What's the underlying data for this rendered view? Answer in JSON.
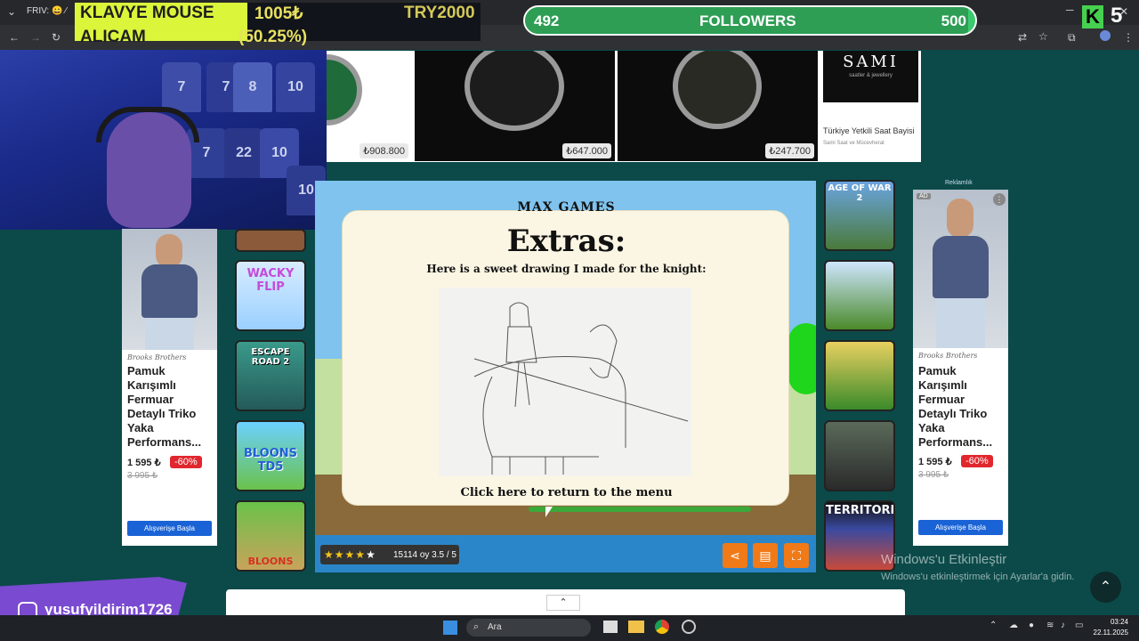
{
  "browser": {
    "tab_label": "FRIV: 😀 ⁄",
    "menu_dots": "⋮",
    "minimize": "─",
    "close": "✕"
  },
  "donation": {
    "line1_left": "KLAVYE MOUSE",
    "line1_mid": "1005₺",
    "line1_right": "TRY2000",
    "line2_left": "ALICAM",
    "line2_mid": "(50.25%)"
  },
  "followers": {
    "current": "492",
    "label": "FOLLOWERS",
    "goal": "500",
    "progress": 0.984
  },
  "kick": {
    "logo": "K",
    "count": "5"
  },
  "webcam": {
    "jersey_numbers": [
      "7",
      "7",
      "8",
      "10",
      "7",
      "22",
      "10",
      "10"
    ]
  },
  "top_ads": {
    "items": [
      {
        "price": "₺908.800"
      },
      {
        "price": "₺647.000"
      },
      {
        "price": "₺247.700"
      }
    ],
    "sami": {
      "logo": "SAMI",
      "logo_sub": "saatler & jewellery",
      "title": "Türkiye Yetkili Saat Bayisi",
      "subtitle": "Sami Saat ve Mücevherat"
    }
  },
  "game": {
    "logo": "MAX GAMES",
    "heading": "Extras:",
    "caption": "Here is a sweet drawing I made for the knight:",
    "return_link": "Click here to return to the menu",
    "rating_text": "15114 oy 3.5 / 5",
    "rating_value": 3.5,
    "rating_max": 5,
    "share_icon": "share-icon",
    "comment_icon": "comment-icon",
    "fullscreen_icon": "fullscreen-icon"
  },
  "left_thumbs": [
    {
      "label": ""
    },
    {
      "label": "WACKY FLIP"
    },
    {
      "label": "ESCAPE ROAD 2"
    },
    {
      "label": "BLOONS TD5"
    },
    {
      "label": "BLOONS"
    }
  ],
  "right_thumbs": [
    {
      "label": "AGE OF WAR 2"
    },
    {
      "label": ""
    },
    {
      "label": ""
    },
    {
      "label": ""
    },
    {
      "label": "TERRITORIAL"
    }
  ],
  "side_ads": {
    "reklam_label": "Reklamlık",
    "ad_badge": "AD",
    "brand": "Brooks Brothers",
    "title": "Pamuk Karışımlı Fermuar Detaylı Triko Yaka Performans...",
    "price": "1 595 ₺",
    "discount": "-60%",
    "old_price": "3 995 ₺",
    "button": "Alışverişe Başla"
  },
  "windows": {
    "activation_title": "Windows'u Etkinleştir",
    "activation_sub": "Windows'u etkinleştirmek için Ayarlar'a gidin.",
    "search_placeholder": "Ara",
    "time": "03:24",
    "date": "22.11.2025"
  },
  "instagram": {
    "handle": "yusufyildirim1726"
  },
  "colors": {
    "page_bg": "#0b4a49",
    "game_bg": "#4aa7e8",
    "accent_orange": "#f07a18",
    "followers_green": "#3dc96e",
    "donation_yellow": "#dbf53b",
    "discount_red": "#e1262d"
  }
}
